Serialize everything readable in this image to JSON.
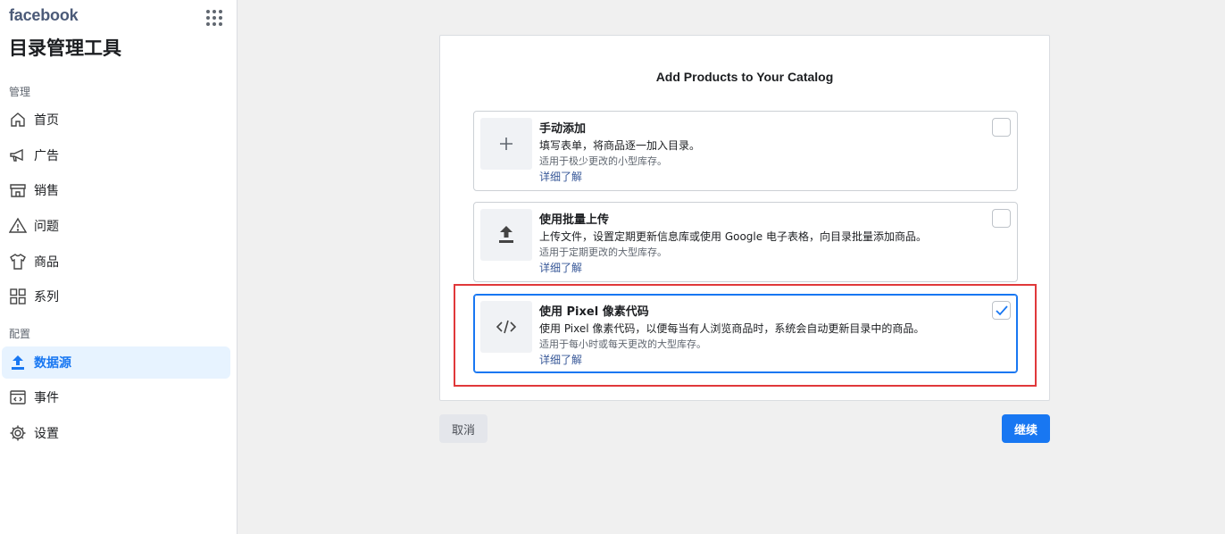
{
  "brand": "facebook",
  "app_title": "目录管理工具",
  "sidebar": {
    "section_manage": "管理",
    "section_config": "配置",
    "items": [
      {
        "label": "首页",
        "icon": "home-icon"
      },
      {
        "label": "广告",
        "icon": "megaphone-icon"
      },
      {
        "label": "销售",
        "icon": "shop-icon"
      },
      {
        "label": "问题",
        "icon": "warning-icon"
      },
      {
        "label": "商品",
        "icon": "shirt-icon"
      },
      {
        "label": "系列",
        "icon": "grid-icon"
      },
      {
        "label": "数据源",
        "icon": "upload-icon",
        "active": true
      },
      {
        "label": "事件",
        "icon": "code-window-icon"
      },
      {
        "label": "设置",
        "icon": "gear-icon"
      }
    ]
  },
  "card": {
    "title": "Add Products to Your Catalog",
    "options": [
      {
        "title": "手动添加",
        "description": "填写表单，将商品逐一加入目录。",
        "note": "适用于极少更改的小型库存。",
        "link": "详细了解",
        "icon": "plus-icon",
        "checked": false
      },
      {
        "title": "使用批量上传",
        "description": "上传文件，设置定期更新信息库或使用 Google 电子表格，向目录批量添加商品。",
        "note": "适用于定期更改的大型库存。",
        "link": "详细了解",
        "icon": "upload-icon",
        "checked": false
      },
      {
        "title": "使用 Pixel 像素代码",
        "description": "使用 Pixel 像素代码，以便每当有人浏览商品时，系统会自动更新目录中的商品。",
        "note": "适用于每小时或每天更改的大型库存。",
        "link": "详细了解",
        "icon": "code-icon",
        "checked": true
      }
    ]
  },
  "buttons": {
    "cancel": "取消",
    "continue": "继续"
  },
  "colors": {
    "accent": "#1877f2",
    "highlight": "#e0383a"
  }
}
